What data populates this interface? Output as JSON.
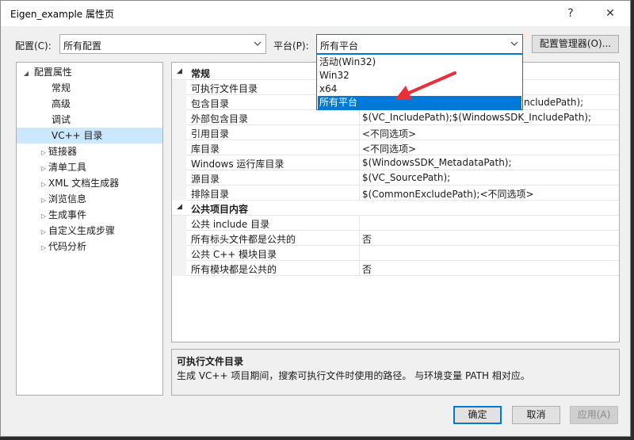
{
  "window": {
    "title": "Eigen_example 属性页",
    "help_glyph": "?",
    "close_glyph": "✕"
  },
  "toolbar": {
    "config_label": "配置(C):",
    "config_value": "所有配置",
    "platform_label": "平台(P):",
    "platform_value": "所有平台",
    "config_manager_label": "配置管理器(O)..."
  },
  "platform_dropdown": {
    "options": [
      "活动(Win32)",
      "Win32",
      "x64",
      "所有平台"
    ],
    "selected": "所有平台"
  },
  "tree": {
    "root": "配置属性",
    "children": [
      "常规",
      "高级",
      "调试",
      "VC++ 目录"
    ],
    "selected": "VC++ 目录",
    "collapsed": [
      "链接器",
      "清单工具",
      "XML 文档生成器",
      "浏览信息",
      "生成事件",
      "自定义生成步骤",
      "代码分析"
    ]
  },
  "grid": {
    "sections": [
      {
        "title": "常规",
        "rows": [
          {
            "name": "可执行文件目录",
            "value": ""
          },
          {
            "name": "包含目录",
            "value": "ncludePath);"
          },
          {
            "name": "外部包含目录",
            "value": "$(VC_IncludePath);$(WindowsSDK_IncludePath);"
          },
          {
            "name": "引用目录",
            "value": "<不同选项>"
          },
          {
            "name": "库目录",
            "value": "<不同选项>"
          },
          {
            "name": "Windows 运行库目录",
            "value": "$(WindowsSDK_MetadataPath);"
          },
          {
            "name": "源目录",
            "value": "$(VC_SourcePath);"
          },
          {
            "name": "排除目录",
            "value": "$(CommonExcludePath);<不同选项>"
          }
        ]
      },
      {
        "title": "公共项目内容",
        "rows": [
          {
            "name": "公共 include 目录",
            "value": ""
          },
          {
            "name": "所有标头文件都是公共的",
            "value": "否"
          },
          {
            "name": "公共 C++ 模块目录",
            "value": ""
          },
          {
            "name": "所有模块都是公共的",
            "value": "否"
          }
        ]
      }
    ]
  },
  "description": {
    "title": "可执行文件目录",
    "text": "生成 VC++ 项目期间，搜索可执行文件时使用的路径。 与环境变量 PATH 相对应。"
  },
  "footer": {
    "ok_label": "确定",
    "cancel_label": "取消",
    "apply_label": "应用(A)"
  },
  "colors": {
    "accent": "#0078d7",
    "annotation_arrow": "#e8303a"
  }
}
